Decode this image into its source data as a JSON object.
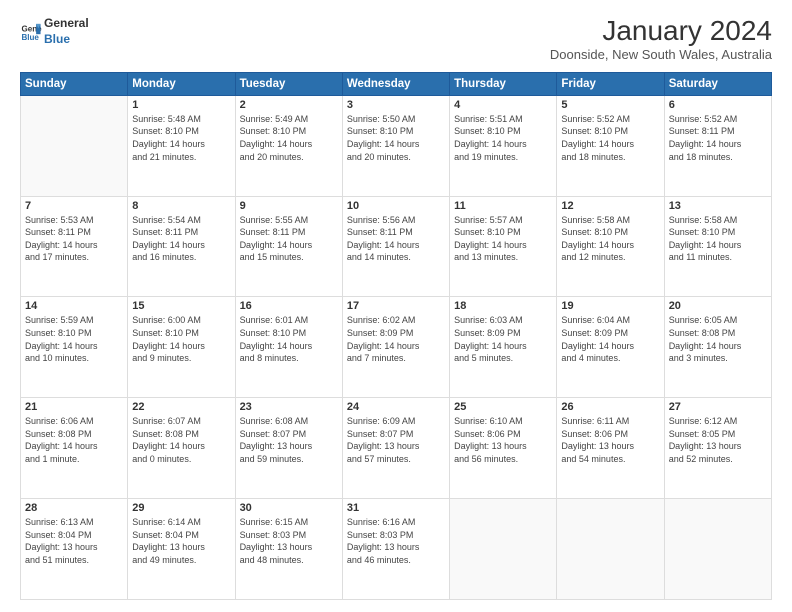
{
  "logo": {
    "line1": "General",
    "line2": "Blue"
  },
  "title": "January 2024",
  "subtitle": "Doonside, New South Wales, Australia",
  "days_header": [
    "Sunday",
    "Monday",
    "Tuesday",
    "Wednesday",
    "Thursday",
    "Friday",
    "Saturday"
  ],
  "weeks": [
    [
      {
        "day": "",
        "info": ""
      },
      {
        "day": "1",
        "info": "Sunrise: 5:48 AM\nSunset: 8:10 PM\nDaylight: 14 hours\nand 21 minutes."
      },
      {
        "day": "2",
        "info": "Sunrise: 5:49 AM\nSunset: 8:10 PM\nDaylight: 14 hours\nand 20 minutes."
      },
      {
        "day": "3",
        "info": "Sunrise: 5:50 AM\nSunset: 8:10 PM\nDaylight: 14 hours\nand 20 minutes."
      },
      {
        "day": "4",
        "info": "Sunrise: 5:51 AM\nSunset: 8:10 PM\nDaylight: 14 hours\nand 19 minutes."
      },
      {
        "day": "5",
        "info": "Sunrise: 5:52 AM\nSunset: 8:10 PM\nDaylight: 14 hours\nand 18 minutes."
      },
      {
        "day": "6",
        "info": "Sunrise: 5:52 AM\nSunset: 8:11 PM\nDaylight: 14 hours\nand 18 minutes."
      }
    ],
    [
      {
        "day": "7",
        "info": "Sunrise: 5:53 AM\nSunset: 8:11 PM\nDaylight: 14 hours\nand 17 minutes."
      },
      {
        "day": "8",
        "info": "Sunrise: 5:54 AM\nSunset: 8:11 PM\nDaylight: 14 hours\nand 16 minutes."
      },
      {
        "day": "9",
        "info": "Sunrise: 5:55 AM\nSunset: 8:11 PM\nDaylight: 14 hours\nand 15 minutes."
      },
      {
        "day": "10",
        "info": "Sunrise: 5:56 AM\nSunset: 8:11 PM\nDaylight: 14 hours\nand 14 minutes."
      },
      {
        "day": "11",
        "info": "Sunrise: 5:57 AM\nSunset: 8:10 PM\nDaylight: 14 hours\nand 13 minutes."
      },
      {
        "day": "12",
        "info": "Sunrise: 5:58 AM\nSunset: 8:10 PM\nDaylight: 14 hours\nand 12 minutes."
      },
      {
        "day": "13",
        "info": "Sunrise: 5:58 AM\nSunset: 8:10 PM\nDaylight: 14 hours\nand 11 minutes."
      }
    ],
    [
      {
        "day": "14",
        "info": "Sunrise: 5:59 AM\nSunset: 8:10 PM\nDaylight: 14 hours\nand 10 minutes."
      },
      {
        "day": "15",
        "info": "Sunrise: 6:00 AM\nSunset: 8:10 PM\nDaylight: 14 hours\nand 9 minutes."
      },
      {
        "day": "16",
        "info": "Sunrise: 6:01 AM\nSunset: 8:10 PM\nDaylight: 14 hours\nand 8 minutes."
      },
      {
        "day": "17",
        "info": "Sunrise: 6:02 AM\nSunset: 8:09 PM\nDaylight: 14 hours\nand 7 minutes."
      },
      {
        "day": "18",
        "info": "Sunrise: 6:03 AM\nSunset: 8:09 PM\nDaylight: 14 hours\nand 5 minutes."
      },
      {
        "day": "19",
        "info": "Sunrise: 6:04 AM\nSunset: 8:09 PM\nDaylight: 14 hours\nand 4 minutes."
      },
      {
        "day": "20",
        "info": "Sunrise: 6:05 AM\nSunset: 8:08 PM\nDaylight: 14 hours\nand 3 minutes."
      }
    ],
    [
      {
        "day": "21",
        "info": "Sunrise: 6:06 AM\nSunset: 8:08 PM\nDaylight: 14 hours\nand 1 minute."
      },
      {
        "day": "22",
        "info": "Sunrise: 6:07 AM\nSunset: 8:08 PM\nDaylight: 14 hours\nand 0 minutes."
      },
      {
        "day": "23",
        "info": "Sunrise: 6:08 AM\nSunset: 8:07 PM\nDaylight: 13 hours\nand 59 minutes."
      },
      {
        "day": "24",
        "info": "Sunrise: 6:09 AM\nSunset: 8:07 PM\nDaylight: 13 hours\nand 57 minutes."
      },
      {
        "day": "25",
        "info": "Sunrise: 6:10 AM\nSunset: 8:06 PM\nDaylight: 13 hours\nand 56 minutes."
      },
      {
        "day": "26",
        "info": "Sunrise: 6:11 AM\nSunset: 8:06 PM\nDaylight: 13 hours\nand 54 minutes."
      },
      {
        "day": "27",
        "info": "Sunrise: 6:12 AM\nSunset: 8:05 PM\nDaylight: 13 hours\nand 52 minutes."
      }
    ],
    [
      {
        "day": "28",
        "info": "Sunrise: 6:13 AM\nSunset: 8:04 PM\nDaylight: 13 hours\nand 51 minutes."
      },
      {
        "day": "29",
        "info": "Sunrise: 6:14 AM\nSunset: 8:04 PM\nDaylight: 13 hours\nand 49 minutes."
      },
      {
        "day": "30",
        "info": "Sunrise: 6:15 AM\nSunset: 8:03 PM\nDaylight: 13 hours\nand 48 minutes."
      },
      {
        "day": "31",
        "info": "Sunrise: 6:16 AM\nSunset: 8:03 PM\nDaylight: 13 hours\nand 46 minutes."
      },
      {
        "day": "",
        "info": ""
      },
      {
        "day": "",
        "info": ""
      },
      {
        "day": "",
        "info": ""
      }
    ]
  ]
}
